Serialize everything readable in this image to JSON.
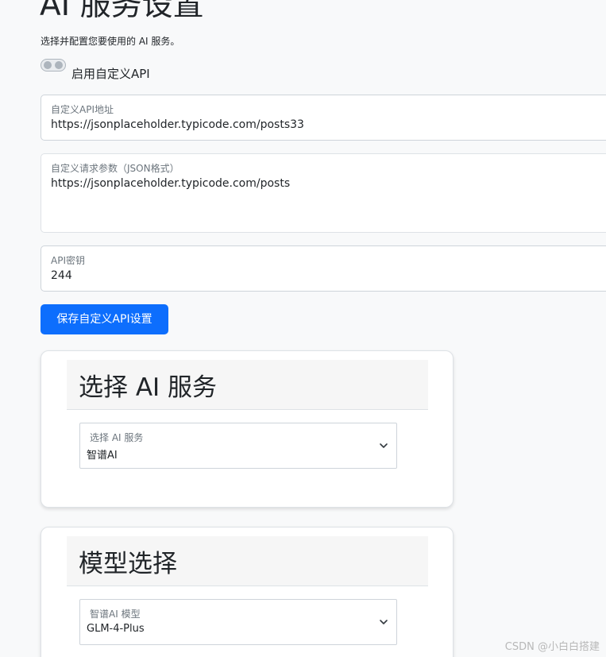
{
  "page": {
    "title": "AI 服务设置",
    "subtitle": "选择并配置您要使用的 AI 服务。"
  },
  "custom_api": {
    "toggle_label": "启用自定义API",
    "toggle_on": false,
    "url_label": "自定义API地址",
    "url_value": "https://jsonplaceholder.typicode.com/posts33",
    "params_label": "自定义请求参数（JSON格式）",
    "params_value": "https://jsonplaceholder.typicode.com/posts",
    "key_label": "API密钥",
    "key_value": "244",
    "save_label": "保存自定义API设置"
  },
  "service_card": {
    "title": "选择 AI 服务",
    "select_label": "选择 AI 服务",
    "select_value": "智谱AI"
  },
  "model_card": {
    "title": "模型选择",
    "select_label": "智谱AI 模型",
    "select_value": "GLM-4-Plus"
  },
  "watermark": "CSDN @小白白搭建",
  "colors": {
    "primary": "#0d6efd",
    "background": "#f8f9fa",
    "border": "#ced4da"
  },
  "icons": {
    "select_chevron": "chevron-down-icon"
  }
}
